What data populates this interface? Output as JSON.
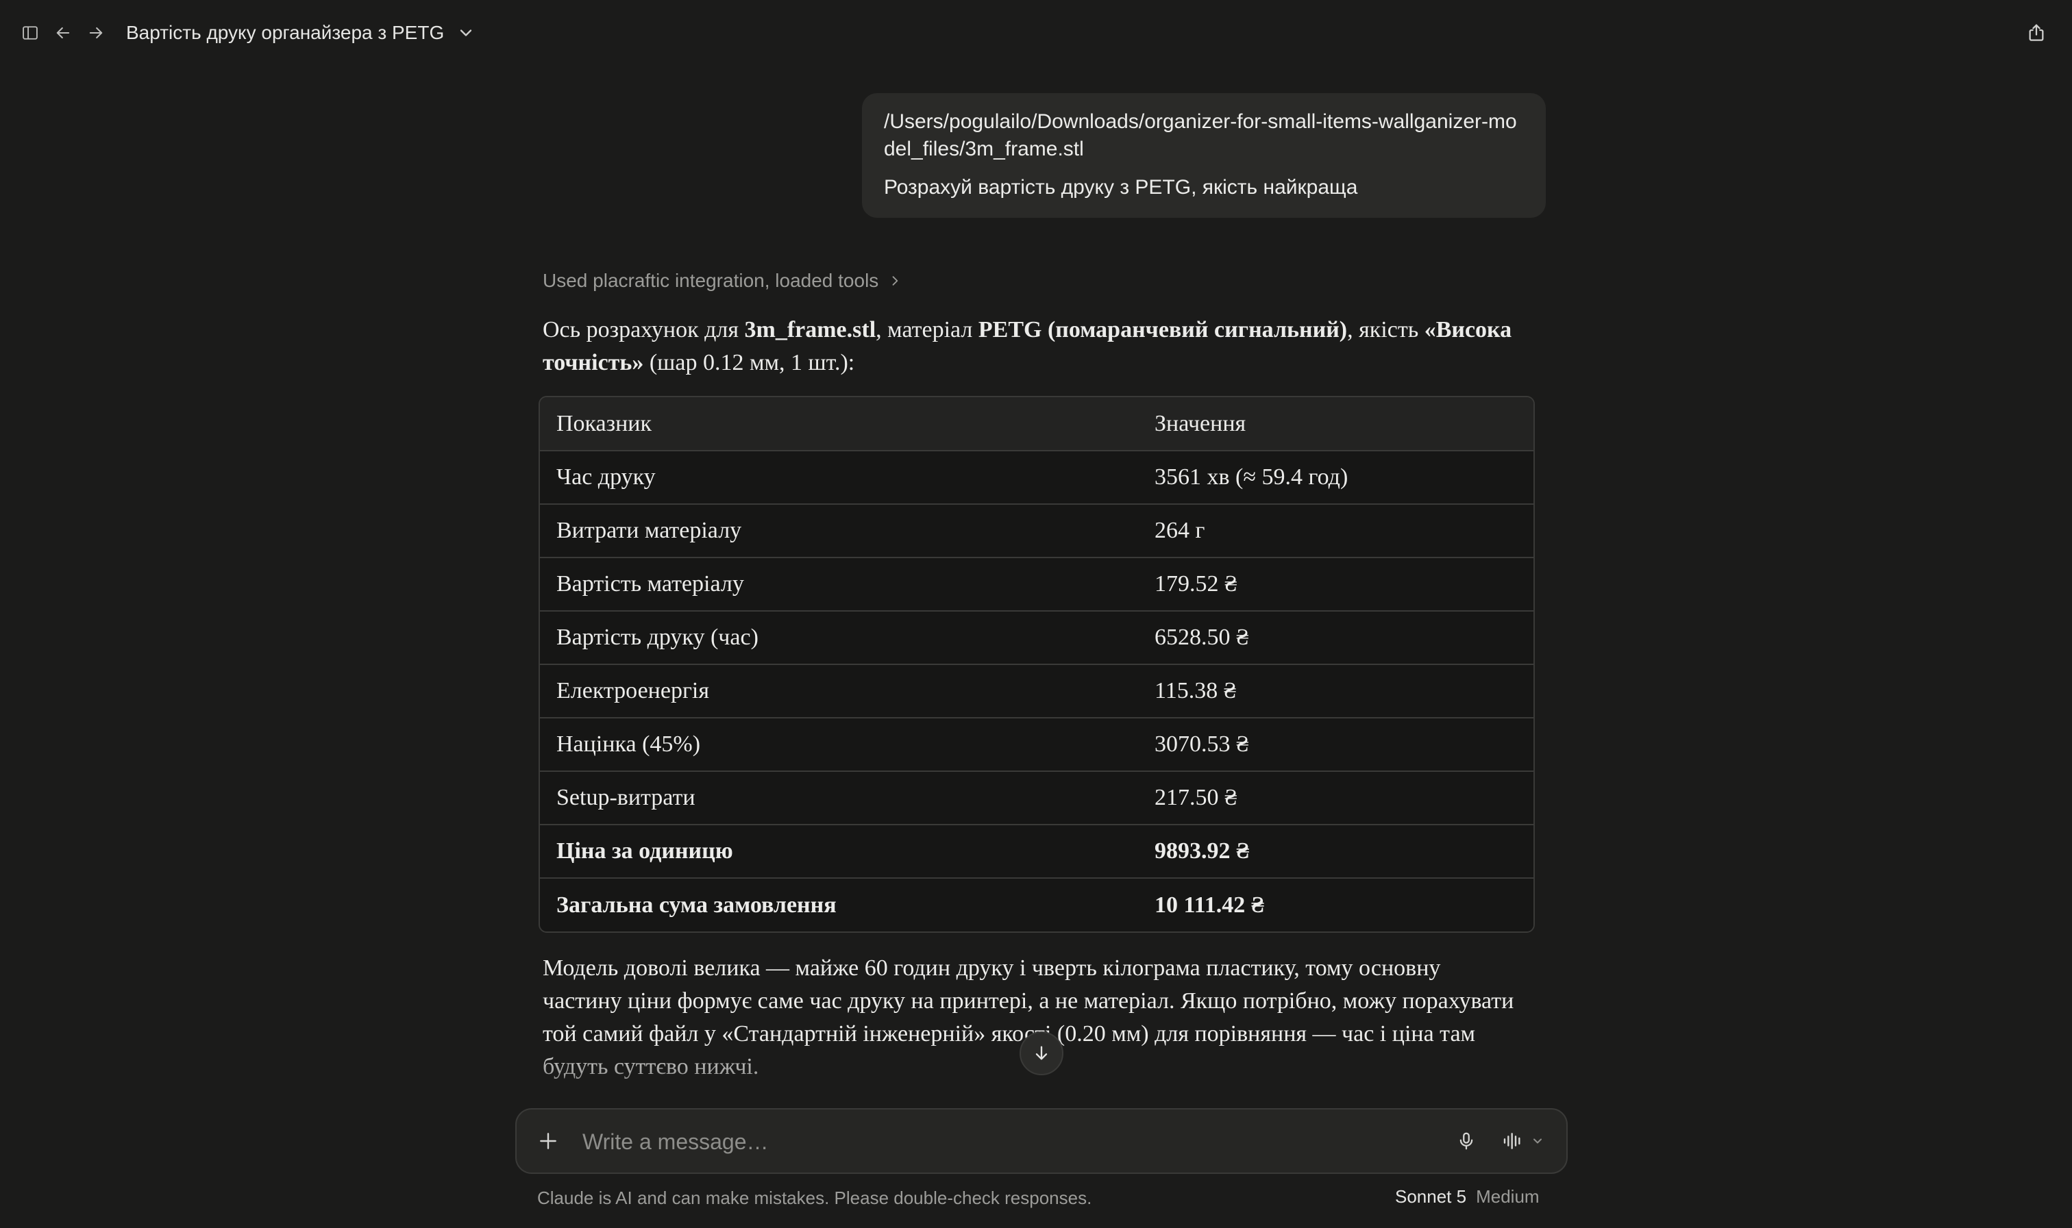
{
  "header": {
    "title": "Вартість друку органайзера з PETG"
  },
  "user_message": {
    "file_path": "/Users/pogulailo/Downloads/organizer-for-small-items-wallganizer-model_files/3m_frame.stl",
    "text": "Розрахуй вартість друку з PETG, якість найкраща"
  },
  "assistant": {
    "tools_line": "Used placraftic integration, loaded tools",
    "intro": {
      "p1": "Ось розрахунок для ",
      "file": "3m_frame.stl",
      "p2": ", матеріал ",
      "material": "PETG (помаранчевий сигнальний)",
      "p3": ", якість ",
      "quality": "«Висока точність»",
      "p4": " (шар 0.12 мм, 1 шт.):"
    },
    "table": {
      "headers": [
        "Показник",
        "Значення"
      ],
      "rows": [
        {
          "label": "Час друку",
          "value": "3561 хв (≈ 59.4 год)",
          "bold": false
        },
        {
          "label": "Витрати матеріалу",
          "value": "264 г",
          "bold": false
        },
        {
          "label": "Вартість матеріалу",
          "value": "179.52 ₴",
          "bold": false
        },
        {
          "label": "Вартість друку (час)",
          "value": "6528.50 ₴",
          "bold": false
        },
        {
          "label": "Електроенергія",
          "value": "115.38 ₴",
          "bold": false
        },
        {
          "label": "Націнка (45%)",
          "value": "3070.53 ₴",
          "bold": false
        },
        {
          "label": "Setup-витрати",
          "value": "217.50 ₴",
          "bold": false
        },
        {
          "label": "Ціна за одиницю",
          "value": "9893.92 ₴",
          "bold": true
        },
        {
          "label": "Загальна сума замовлення",
          "value": "10 111.42 ₴",
          "bold": true
        }
      ]
    },
    "outro": "Модель доволі велика — майже 60 годин друку і чверть кілограма пластику, тому основну частину ціни формує саме час друку на принтері, а не матеріал. Якщо потрібно, можу порахувати той самий файл у «Стандартній інженерній» якості (0.20 мм) для порівняння — час і ціна там будуть суттєво нижчі."
  },
  "composer": {
    "placeholder": "Write a message…"
  },
  "footer": {
    "disclaimer": "Claude is AI and can make mistakes. Please double-check responses.",
    "model_name": "Sonnet 5",
    "model_mode": "Medium"
  },
  "icons": {
    "sidebar_toggle": "sidebar-icon",
    "back": "arrow-left-icon",
    "forward": "arrow-right-icon",
    "title_menu": "chevron-down-icon",
    "share": "share-icon",
    "scroll": "arrow-down-icon",
    "attach": "plus-icon",
    "mic": "microphone-icon",
    "voice": "voice-waveform-icon"
  }
}
